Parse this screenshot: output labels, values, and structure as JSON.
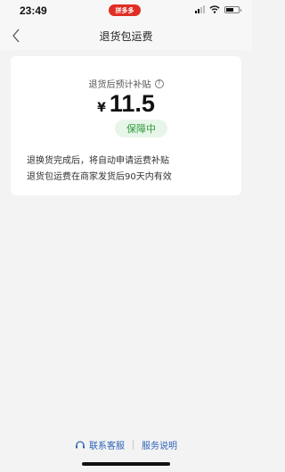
{
  "status_bar": {
    "time": "23:49",
    "app_badge": "拼多多",
    "icons": [
      "cellular-signal-icon",
      "wifi-icon",
      "battery-icon"
    ]
  },
  "header": {
    "title": "退货包运费",
    "back_icon": "chevron-left-icon"
  },
  "card": {
    "estimate_label": "退货后预计补贴",
    "info_icon": "info-circle-icon",
    "currency": "¥",
    "amount": "11.5",
    "status": "保障中",
    "description_lines": [
      "退换货完成后，将自动申请运费补贴",
      "退货包运费在商家发货后90天内有效"
    ]
  },
  "footer": {
    "contact_label": "联系客服",
    "contact_icon": "headset-icon",
    "service_label": "服务说明"
  },
  "colors": {
    "background": "#f3f3f3",
    "brand_red": "#e02e24",
    "status_green": "#2f9b3d",
    "status_green_bg": "#e8f6e9",
    "link_blue": "#2e63b8"
  }
}
